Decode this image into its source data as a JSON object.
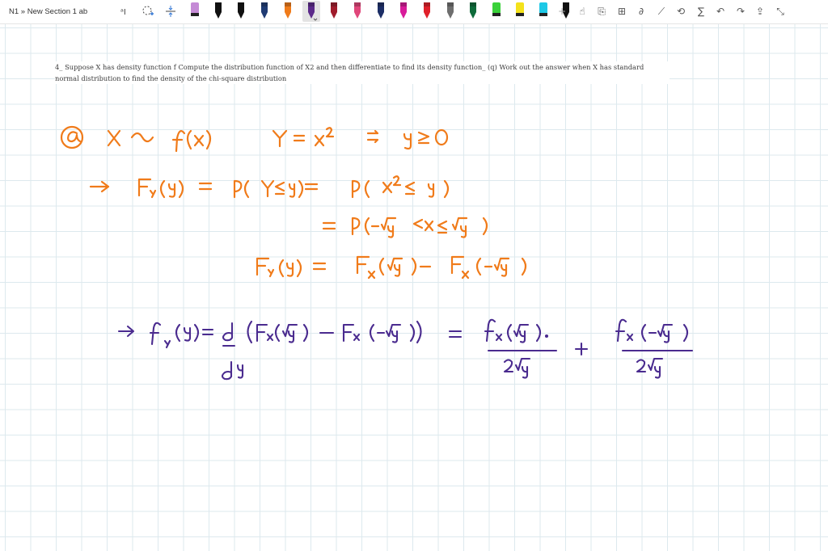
{
  "window": {
    "title": "N1 » New Section 1 ab"
  },
  "toolbar": {
    "tools": [
      {
        "name": "lasso-select-icon"
      },
      {
        "name": "ink-to-shape-icon"
      },
      {
        "name": "add-space-icon"
      }
    ],
    "pens": [
      {
        "name": "highlighter-purple",
        "color": "#c58bd6"
      },
      {
        "name": "pen-black-1",
        "color": "#111111"
      },
      {
        "name": "pen-black-2",
        "color": "#111111"
      },
      {
        "name": "pen-dark-blue",
        "color": "#1f3b73"
      },
      {
        "name": "pen-orange",
        "color": "#f07b1a"
      },
      {
        "name": "pen-purple",
        "color": "#5b2a8a",
        "active": true
      },
      {
        "name": "pen-dark-red",
        "color": "#a01c2c"
      },
      {
        "name": "pen-pink",
        "color": "#e0467a"
      },
      {
        "name": "pen-navy",
        "color": "#1c2e66"
      },
      {
        "name": "pen-magenta",
        "color": "#d81b9a"
      },
      {
        "name": "pen-red",
        "color": "#e0202a"
      },
      {
        "name": "pen-gray",
        "color": "#6e6e6e"
      },
      {
        "name": "pen-dark-green",
        "color": "#0e6b3a"
      },
      {
        "name": "highlighter-green",
        "color": "#3ad13a"
      },
      {
        "name": "highlighter-yellow",
        "color": "#f4e21b"
      },
      {
        "name": "highlighter-cyan",
        "color": "#1ec8e6"
      },
      {
        "name": "pen-black-3",
        "color": "#111111"
      }
    ],
    "right_tools": [
      "add-pen-icon",
      "touch-writing-icon",
      "lasso-icon",
      "ink-to-text-icon",
      "ink-to-math-icon",
      "ruler-icon",
      "ink-replay-icon",
      "math-icon",
      "undo-icon",
      "redo-icon",
      "share-icon",
      "collapse-icon"
    ]
  },
  "question": {
    "text": "4_ Suppose X has density function f Compute the distribution function of X2 and then differentiate to find its density function_ (q) Work out the answer when X has standard normal distribution to find the density of the chi-square distribution"
  },
  "ink": {
    "orange_color": "#f07b1a",
    "purple_color": "#4a2b8f"
  }
}
